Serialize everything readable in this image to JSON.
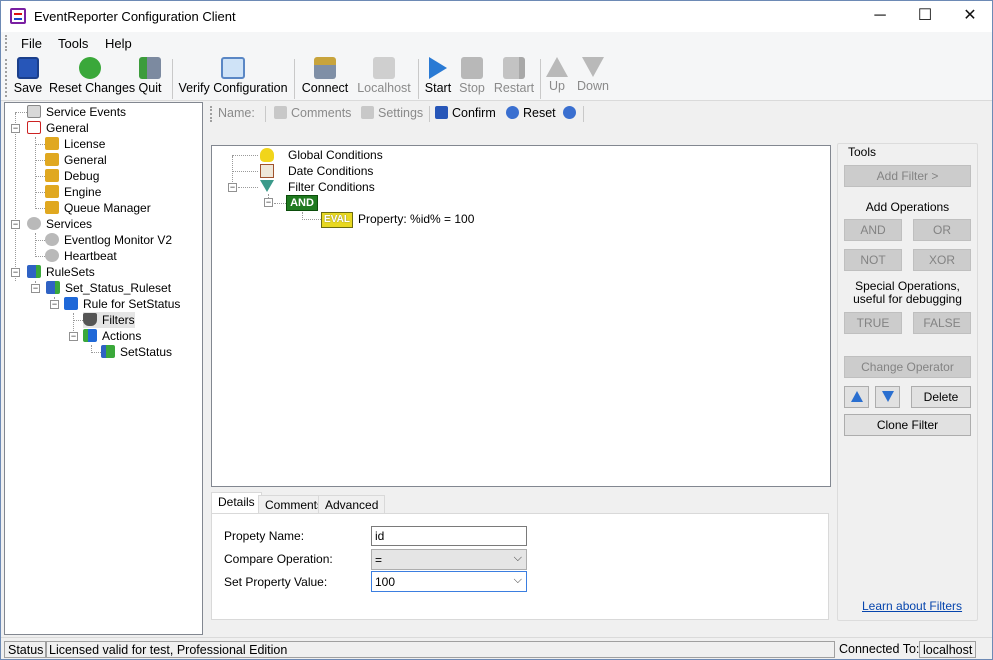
{
  "window": {
    "title": "EventReporter Configuration Client",
    "minimize": "─",
    "maximize": "☐",
    "close": "✕"
  },
  "menu": [
    "File",
    "Tools",
    "Help"
  ],
  "toolbar": {
    "save": "Save",
    "reset_changes": "Reset Changes",
    "quit": "Quit",
    "verify": "Verify Configuration",
    "connect": "Connect",
    "localhost": "Localhost",
    "start": "Start",
    "stop": "Stop",
    "restart": "Restart",
    "up": "Up",
    "down": "Down"
  },
  "tree": {
    "service_events": "Service Events",
    "general": "General",
    "license": "License",
    "general_child": "General",
    "debug": "Debug",
    "engine": "Engine",
    "queue_manager": "Queue Manager",
    "services": "Services",
    "eventlog_monitor": "Eventlog Monitor V2",
    "heartbeat": "Heartbeat",
    "rulesets": "RuleSets",
    "ruleset": "Set_Status_Ruleset",
    "rule": "Rule for SetStatus",
    "filters": "Filters",
    "actions": "Actions",
    "setstatus": "SetStatus"
  },
  "subbar": {
    "name": "Name:",
    "comments": "Comments",
    "settings": "Settings",
    "confirm": "Confirm",
    "reset": "Reset"
  },
  "filter_tree": {
    "global": "Global Conditions",
    "date": "Date Conditions",
    "filter": "Filter Conditions",
    "and": "AND",
    "eval": "EVAL",
    "property": "Property: %id% = 100"
  },
  "tabs": [
    "Details",
    "Comments",
    "Advanced"
  ],
  "details": {
    "property_name_label": "Propety Name:",
    "property_name_value": "id",
    "compare_label": "Compare Operation:",
    "compare_value": "=",
    "set_value_label": "Set Property Value:",
    "set_value_value": "100"
  },
  "tools": {
    "title": "Tools",
    "add_filter": "Add Filter >",
    "add_operations": "Add Operations",
    "and": "AND",
    "or": "OR",
    "not": "NOT",
    "xor": "XOR",
    "special_line1": "Special Operations,",
    "special_line2": "useful for debugging",
    "true": "TRUE",
    "false": "FALSE",
    "change_operator": "Change Operator",
    "delete": "Delete",
    "clone_filter": "Clone Filter",
    "learn_link": "Learn about Filters"
  },
  "status": {
    "label": "Status",
    "license_text": "Licensed valid for test, Professional Edition",
    "connected_label": "Connected To:",
    "host": "localhost"
  }
}
